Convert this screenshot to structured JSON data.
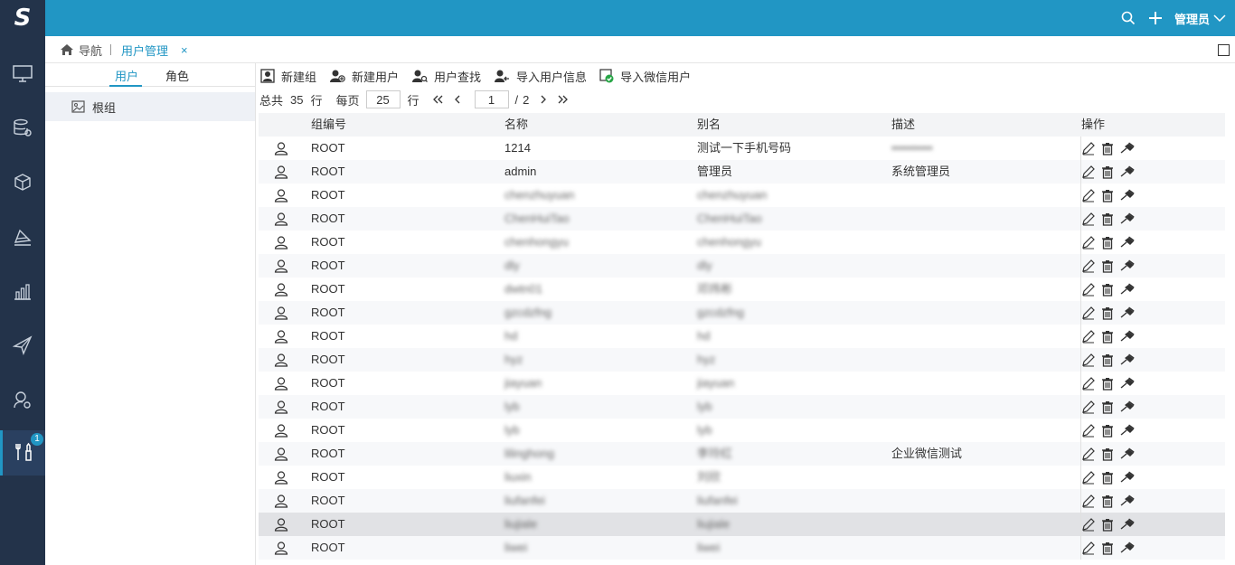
{
  "app": {
    "logo_text": "S",
    "admin_label": "管理员"
  },
  "tabs": {
    "home": "导航",
    "current": "用户管理",
    "close": "×"
  },
  "nav": {
    "badge": "1",
    "items": [
      "monitor-icon",
      "database-settings-icon",
      "cube-icon",
      "stack-chart-icon",
      "bar-chart-icon",
      "paper-plane-icon",
      "user-settings-icon",
      "tools-icon"
    ]
  },
  "left_panel": {
    "tab_user": "用户",
    "tab_role": "角色",
    "root_group": "根组"
  },
  "toolbar": {
    "new_group": "新建组",
    "new_user": "新建用户",
    "find_user": "用户查找",
    "import_user": "导入用户信息",
    "import_wechat": "导入微信用户"
  },
  "pager": {
    "total_prefix": "总共",
    "total": "35",
    "row_unit": "行",
    "per_page_label": "每页",
    "per_page": "25",
    "row_unit2": "行",
    "current_page": "1",
    "page_sep": "/",
    "total_pages": "2"
  },
  "table": {
    "headers": {
      "group_id": "组编号",
      "name": "名称",
      "alias": "别名",
      "desc": "描述",
      "ops": "操作"
    },
    "rows": [
      {
        "gid": "ROOT",
        "name": "1214",
        "alias": "测试一下手机号码",
        "desc": "••••••••••",
        "name_blur": false,
        "alias_blur": false,
        "desc_blur": true
      },
      {
        "gid": "ROOT",
        "name": "admin",
        "alias": "管理员",
        "desc": "系统管理员",
        "name_blur": false,
        "alias_blur": false,
        "desc_blur": false
      },
      {
        "gid": "ROOT",
        "name": "chenzhuyuan",
        "alias": "chenzhuyuan",
        "desc": "",
        "name_blur": true,
        "alias_blur": true,
        "desc_blur": false
      },
      {
        "gid": "ROOT",
        "name": "ChenHuiTao",
        "alias": "ChenHuiTao",
        "desc": "",
        "name_blur": true,
        "alias_blur": true,
        "desc_blur": false
      },
      {
        "gid": "ROOT",
        "name": "chenhongyu",
        "alias": "chenhongyu",
        "desc": "",
        "name_blur": true,
        "alias_blur": true,
        "desc_blur": false
      },
      {
        "gid": "ROOT",
        "name": "dly",
        "alias": "dly",
        "desc": "",
        "name_blur": true,
        "alias_blur": true,
        "desc_blur": false
      },
      {
        "gid": "ROOT",
        "name": "dwtn01",
        "alias": "邓炜彬",
        "desc": "",
        "name_blur": true,
        "alias_blur": true,
        "desc_blur": false
      },
      {
        "gid": "ROOT",
        "name": "gzcdzfng",
        "alias": "gzcdzfng",
        "desc": "",
        "name_blur": true,
        "alias_blur": true,
        "desc_blur": false
      },
      {
        "gid": "ROOT",
        "name": "hd",
        "alias": "hd",
        "desc": "",
        "name_blur": true,
        "alias_blur": true,
        "desc_blur": false
      },
      {
        "gid": "ROOT",
        "name": "hyz",
        "alias": "hyz",
        "desc": "",
        "name_blur": true,
        "alias_blur": true,
        "desc_blur": false
      },
      {
        "gid": "ROOT",
        "name": "jiayuan",
        "alias": "jiayuan",
        "desc": "",
        "name_blur": true,
        "alias_blur": true,
        "desc_blur": false
      },
      {
        "gid": "ROOT",
        "name": "lyb",
        "alias": "lyb",
        "desc": "",
        "name_blur": true,
        "alias_blur": true,
        "desc_blur": false
      },
      {
        "gid": "ROOT",
        "name": "lyb",
        "alias": "lyb",
        "desc": "",
        "name_blur": true,
        "alias_blur": true,
        "desc_blur": false
      },
      {
        "gid": "ROOT",
        "name": "lilinghong",
        "alias": "李玲红",
        "desc": "企业微信测试",
        "name_blur": true,
        "alias_blur": true,
        "desc_blur": false
      },
      {
        "gid": "ROOT",
        "name": "liuxin",
        "alias": "刘欣",
        "desc": "",
        "name_blur": true,
        "alias_blur": true,
        "desc_blur": false
      },
      {
        "gid": "ROOT",
        "name": "liufanfei",
        "alias": "liufanfei",
        "desc": "",
        "name_blur": true,
        "alias_blur": true,
        "desc_blur": false
      },
      {
        "gid": "ROOT",
        "name": "liujiale",
        "alias": "liujiale",
        "desc": "",
        "name_blur": true,
        "alias_blur": true,
        "desc_blur": false
      },
      {
        "gid": "ROOT",
        "name": "liwei",
        "alias": "liwei",
        "desc": "",
        "name_blur": true,
        "alias_blur": true,
        "desc_blur": false
      }
    ],
    "selected_row": 16
  },
  "colors": {
    "accent": "#2196c4",
    "sidebar": "#23334a"
  }
}
